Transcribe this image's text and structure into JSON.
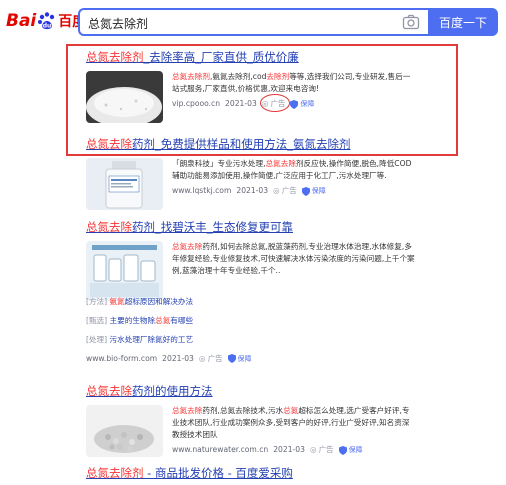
{
  "header": {
    "logo_left": "Bai",
    "logo_right": "百度",
    "query": "总氮去除剂",
    "search_button": "百度一下"
  },
  "results": [
    {
      "title_parts": [
        "总氮去除剂",
        "_去除率高_厂家直供_质优价廉"
      ],
      "desc_parts": [
        "总氮去除剂",
        ",氨氮去除剂,cod",
        "去除剂",
        "等等,选择我们公司,专业研发,售后一站式服务,厂家直供,价格优惠,欢迎来电咨询!"
      ],
      "source": "vip.cpooo.cn",
      "date": "2021-03",
      "ad": "广告",
      "guarantee": "保障"
    },
    {
      "title_parts": [
        "总氮去除",
        "药剂_免费提供样品和使用方法_氨氮去除剂"
      ],
      "desc_parts": [
        "「朗泉科技」专业污水处理,",
        "总氮去除",
        "剂反应快,操作简便,脱色,降低COD辅助功能易添加使用,操作简便,广泛应用于化工厂,污水处理厂等."
      ],
      "source": "www.lqstkj.com",
      "date": "2021-03",
      "ad": "广告",
      "guarantee": "保障"
    },
    {
      "title_parts": [
        "总氮去除",
        "药剂_找碧沃丰_生态修复更可靠"
      ],
      "desc_parts": [
        "总氮去除",
        "药剂,如何去除总氮,脱蓝藻药剂,专业治理水体治理,水体修复,多年修复经验,专业修复技术,可快速解决水体污染浓度的污染问题,上千个案例,蓝藻治理十年专业经验,千个.."
      ],
      "source": "www.bio-form.com",
      "date": "2021-03",
      "ad": "广告",
      "guarantee": "保障",
      "sublinks": [
        {
          "tag": "[方法]",
          "parts": [
            "氨",
            "氮",
            "超标原因和解决办法"
          ]
        },
        {
          "tag": "[甄选]",
          "parts": [
            "主要的生物除",
            "总氮",
            "有哪些"
          ]
        },
        {
          "tag": "[处理]",
          "parts": [
            "污水处理厂除氮好的工艺"
          ]
        }
      ]
    },
    {
      "title_parts": [
        "总氮去除",
        "药剂的使用方法"
      ],
      "desc_parts": [
        "总氮去除",
        "药剂,总氮去除技术,污水",
        "总氮",
        "超标怎么处理,选广受客户好评,专业技术团队,行业成功案例众多,受到客户的好评,行业广受好评,知名资深教授技术团队"
      ],
      "source": "www.naturewater.com.cn",
      "date": "2021-03",
      "ad": "广告",
      "guarantee": "保障"
    },
    {
      "title_parts": [
        "总氮去除剂",
        " - 商品批发价格 - 百度爱采购"
      ]
    }
  ],
  "colors": {
    "brand_blue": "#4e6ef2",
    "link_blue": "#2440b3",
    "highlight_red": "#f73131",
    "annotation_red": "#e03a3a"
  }
}
